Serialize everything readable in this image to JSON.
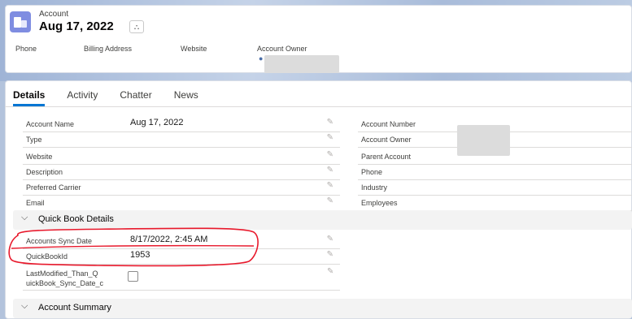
{
  "header": {
    "object_label": "Account",
    "record_title": "Aug 17, 2022",
    "hierarchy_icon": "hierarchy-icon",
    "fields": [
      "Phone",
      "Billing Address",
      "Website",
      "Account Owner"
    ]
  },
  "tabs": [
    "Details",
    "Activity",
    "Chatter",
    "News"
  ],
  "details": {
    "left": [
      {
        "label": "Account Name",
        "value": "Aug 17, 2022"
      },
      {
        "label": "Type",
        "value": ""
      },
      {
        "label": "Website",
        "value": ""
      },
      {
        "label": "Description",
        "value": ""
      },
      {
        "label": "Preferred Carrier",
        "value": ""
      },
      {
        "label": "Email",
        "value": ""
      }
    ],
    "right": [
      {
        "label": "Account Number",
        "value": ""
      },
      {
        "label": "Account Owner",
        "value": ""
      },
      {
        "label": "Parent Account",
        "value": ""
      },
      {
        "label": "Phone",
        "value": ""
      },
      {
        "label": "Industry",
        "value": ""
      },
      {
        "label": "Employees",
        "value": ""
      }
    ]
  },
  "quickbook": {
    "title": "Quick Book Details",
    "rows": [
      {
        "label": "Accounts Sync Date",
        "value": "8/17/2022, 2:45 AM"
      },
      {
        "label": "QuickBookId",
        "value": "1953"
      }
    ],
    "checkbox_label": "LastModified_Than_QuickBook_Sync_Date_c",
    "checkbox_label_line1": "LastModified_Than_Q",
    "checkbox_label_line2": "uickBook_Sync_Date_c",
    "checkbox_checked": false
  },
  "account_summary": {
    "title": "Account Summary"
  },
  "annotation_color": "#e8192c",
  "accent_color": "#0176d3"
}
